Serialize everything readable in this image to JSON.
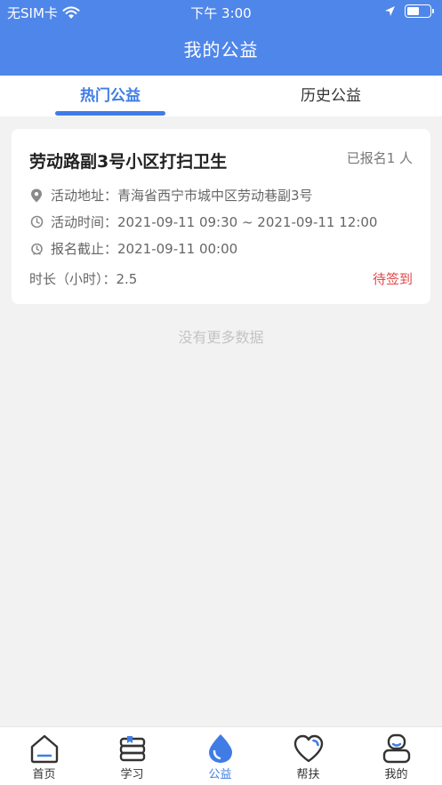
{
  "status_bar": {
    "carrier": "无SIM卡",
    "time": "下午 3:00"
  },
  "header": {
    "title": "我的公益"
  },
  "tabs": [
    {
      "label": "热门公益",
      "active": true
    },
    {
      "label": "历史公益",
      "active": false
    }
  ],
  "activity": {
    "title": "劳动路副3号小区打扫卫生",
    "signup_count": "已报名1 人",
    "address_label": "活动地址：",
    "address": "青海省西宁市城中区劳动巷副3号",
    "time_label": "活动时间：",
    "time": "2021-09-11 09:30 ~ 2021-09-11 12:00",
    "deadline_label": "报名截止：",
    "deadline": "2021-09-11 00:00",
    "duration": "时长（小时）：2.5",
    "status": "待签到"
  },
  "list_footer": "没有更多数据",
  "bottom_nav": [
    {
      "label": "首页",
      "icon": "home-icon",
      "active": false
    },
    {
      "label": "学习",
      "icon": "books-icon",
      "active": false
    },
    {
      "label": "公益",
      "icon": "drop-icon",
      "active": true
    },
    {
      "label": "帮扶",
      "icon": "heart-icon",
      "active": false
    },
    {
      "label": "我的",
      "icon": "profile-icon",
      "active": false
    }
  ],
  "colors": {
    "primary": "#4f86ea",
    "accent": "#3f7ce6",
    "status_red": "#e04848",
    "background": "#f2f2f2"
  }
}
